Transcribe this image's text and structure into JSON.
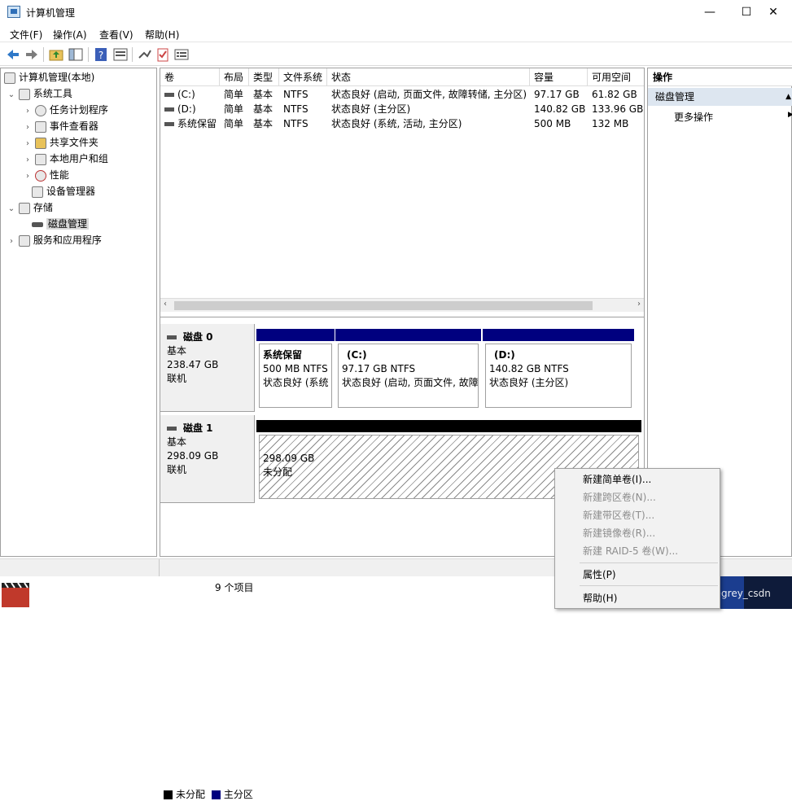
{
  "window": {
    "title": "计算机管理",
    "minimize": "—",
    "maximize": "☐",
    "close": "✕"
  },
  "menu": [
    "文件(F)",
    "操作(A)",
    "查看(V)",
    "帮助(H)"
  ],
  "tree": {
    "root": "计算机管理(本地)",
    "system_tools": "系统工具",
    "items": [
      "任务计划程序",
      "事件查看器",
      "共享文件夹",
      "本地用户和组",
      "性能",
      "设备管理器"
    ],
    "storage": "存储",
    "disk_mgmt": "磁盘管理",
    "services": "服务和应用程序"
  },
  "volume_table": {
    "headers": [
      "卷",
      "布局",
      "类型",
      "文件系统",
      "状态",
      "容量",
      "可用空间"
    ],
    "rows": [
      [
        "(C:)",
        "简单",
        "基本",
        "NTFS",
        "状态良好 (启动, 页面文件, 故障转储, 主分区)",
        "97.17 GB",
        "61.82 GB"
      ],
      [
        "(D:)",
        "简单",
        "基本",
        "NTFS",
        "状态良好 (主分区)",
        "140.82 GB",
        "133.96 GB"
      ],
      [
        "系统保留",
        "简单",
        "基本",
        "NTFS",
        "状态良好 (系统, 活动, 主分区)",
        "500 MB",
        "132 MB"
      ]
    ]
  },
  "disks": [
    {
      "name": "磁盘 0",
      "type": "基本",
      "size": "238.47 GB",
      "status": "联机",
      "partitions": [
        {
          "title": "系统保留",
          "size": "500 MB NTFS",
          "status": "状态良好 (系统"
        },
        {
          "title": "(C:)",
          "size": "97.17 GB NTFS",
          "status": "状态良好 (启动, 页面文件, 故障"
        },
        {
          "title": "(D:)",
          "size": "140.82 GB NTFS",
          "status": "状态良好 (主分区)"
        }
      ]
    },
    {
      "name": "磁盘 1",
      "type": "基本",
      "size": "298.09 GB",
      "status": "联机",
      "partitions": [
        {
          "size": "298.09 GB",
          "status": "未分配"
        }
      ]
    }
  ],
  "legend": {
    "unallocated": "未分配",
    "primary": "主分区"
  },
  "actions": {
    "header": "操作",
    "section": "磁盘管理",
    "more": "更多操作"
  },
  "status_bar": {
    "count": "9 个项目"
  },
  "context_menu": {
    "items": [
      {
        "label": "新建简单卷(I)...",
        "enabled": true
      },
      {
        "label": "新建跨区卷(N)...",
        "enabled": false
      },
      {
        "label": "新建带区卷(T)...",
        "enabled": false
      },
      {
        "label": "新建镜像卷(R)...",
        "enabled": false
      },
      {
        "label": "新建 RAID-5 卷(W)...",
        "enabled": false
      },
      {
        "label": "属性(P)",
        "enabled": true
      },
      {
        "label": "帮助(H)",
        "enabled": true
      }
    ]
  },
  "watermark": "CSDN @grey_csdn",
  "colors": {
    "primary_partition": "#00007f",
    "unallocated": "#000000",
    "selection": "#d9d9d9",
    "action_section": "#dde6f0"
  }
}
